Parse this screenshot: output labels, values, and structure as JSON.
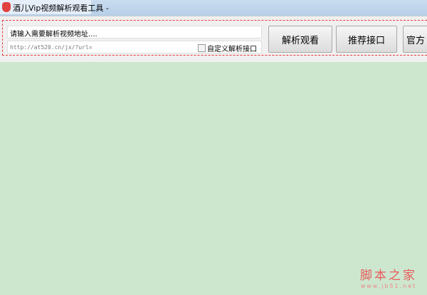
{
  "window": {
    "title": "酒儿Vip视频解析观看工具 -"
  },
  "form": {
    "url_value": "请输入需要解析视频地址....",
    "api_value": "http://at520.cn/jx/?url=",
    "custom_api_label": "自定义解析接口",
    "custom_api_checked": false
  },
  "buttons": {
    "parse": "解析观看",
    "recommend": "推荐接口",
    "official": "官方"
  },
  "watermark": {
    "name": "脚本之家",
    "url": "www.jb51.net"
  }
}
